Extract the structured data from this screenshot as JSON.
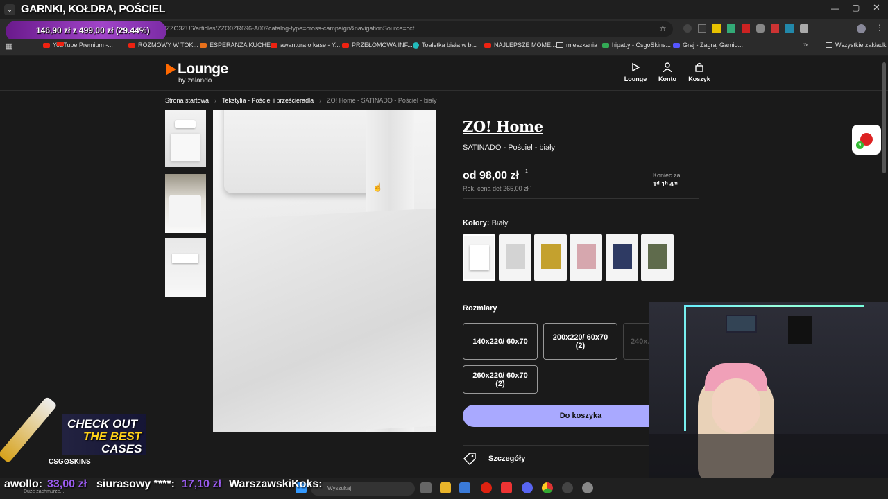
{
  "stream": {
    "title": "GARNKI, KOŁDRA, POŚCIEL",
    "price_tracker": "146,90 zł z 499,00 zł (29.44%)",
    "promo_line1": "CHECK OUT",
    "promo_line2": "THE BEST",
    "promo_line3": "CASES",
    "promo_brand": "CSG⊙SKINS",
    "ticker": [
      {
        "name": "awollo:",
        "amount": "33,00 zł"
      },
      {
        "name": "siurasowy ****:",
        "amount": "17,10 zł"
      },
      {
        "name": "WarszawskiKoks:",
        "amount": ""
      }
    ]
  },
  "browser": {
    "url": "...aigns/ZZO3ZU6/articles/ZZO0ZR696-A00?catalog-type=cross-campaign&navigationSource=ccf",
    "bookmarks": [
      "YouTube Premium -...",
      "ROZMOWY W TOK...",
      "ESPERANZA KUCHE...",
      "awantura o kase - Y...",
      "PRZEŁOMOWA INF...",
      "Toaletka biała w b...",
      "NAJLEPSZE MOME...",
      "mieszkania",
      "hipatty - CsgoSkins...",
      "Graj - Zagraj Gamio...",
      "Wszystkie zakładki"
    ]
  },
  "site": {
    "logo": "Lounge",
    "logo_sub": "by zalando",
    "nav": [
      "Lounge",
      "Konto",
      "Koszyk"
    ],
    "breadcrumb": [
      "Strona startowa",
      "Tekstylia - Pościel i prześcieradła",
      "ZO! Home - SATINADO - Pościel - biały"
    ]
  },
  "product": {
    "brand": "ZO! Home",
    "name": "SATINADO - Pościel - biały",
    "price": "od 98,00 zł",
    "price_note": "Rek. cena det",
    "old_price": "265,00 zł",
    "ends_label": "Koniec za",
    "ends_value": "1ᵈ 1ʰ 4ᵐ",
    "colors_label": "Kolory:",
    "color_value": "Biały",
    "swatch_colors": [
      "#eeeeee",
      "#d3d3d3",
      "#c4a12e",
      "#d6a7ae",
      "#2e3a63",
      "#5f6b4c"
    ],
    "sizes_label": "Rozmiary",
    "sizes": [
      "140x220/ 60x70",
      "200x220/ 60x70 (2)",
      "240x...",
      "260x220/ 60x70 (2)"
    ],
    "cart_button": "Do koszyka",
    "details": "Szczegóły"
  },
  "taskbar": {
    "search_placeholder": "Wyszukaj",
    "weather": "Duże zachmurze..."
  }
}
